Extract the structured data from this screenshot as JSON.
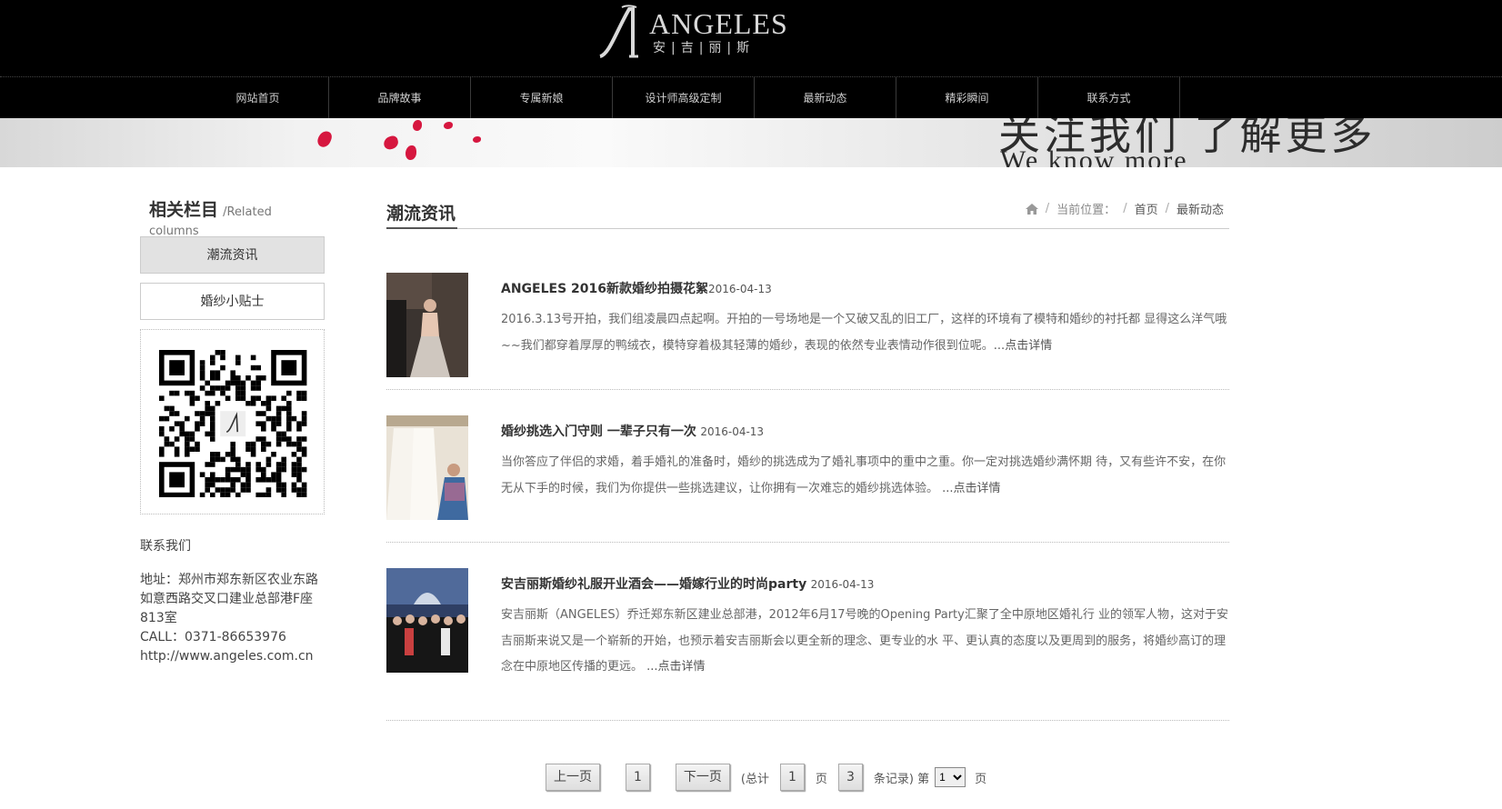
{
  "header": {
    "logo_en": "ANGELES",
    "logo_cn": "安|吉|丽|斯"
  },
  "nav": {
    "items": [
      "网站首页",
      "品牌故事",
      "专属新娘",
      "设计师高级定制",
      "最新动态",
      "精彩瞬间",
      "联系方式"
    ]
  },
  "banner": {
    "slogan": "关注我们 了解更多",
    "slogan_en": "We know more"
  },
  "sidebar": {
    "title_cn": "相关栏目",
    "title_en": "/Related columns",
    "items": [
      "潮流资讯",
      "婚纱小贴士"
    ],
    "contact_title": "联系我们",
    "address_line1": "地址：郑州市郑东新区农业东路",
    "address_line2": "如意西路交叉口建业总部港F座",
    "address_line3": "813室",
    "phone": "CALL：0371-86653976",
    "website": "http://www.angeles.com.cn"
  },
  "main": {
    "title": "潮流资讯",
    "breadcrumb": {
      "prefix": "当前位置：",
      "home": "首页",
      "current": "最新动态"
    },
    "articles": [
      {
        "title": "ANGELES 2016新款婚纱拍摄花絮",
        "date": "2016-04-13",
        "summary": "2016.3.13号开拍，我们组凌晨四点起啊。开拍的一号场地是一个又破又乱的旧工厂，这样的环境有了模特和婚纱的衬托都 显得这么洋气哦~~我们都穿着厚厚的鸭绒衣，模特穿着极其轻薄的婚纱，表现的依然专业表情动作很到位呢。",
        "more": "...点击详情"
      },
      {
        "title": "婚纱挑选入门守则 一辈子只有一次",
        "date": "2016-04-13",
        "summary": "当你答应了伴侣的求婚，着手婚礼的准备时，婚纱的挑选成为了婚礼事项中的重中之重。你一定对挑选婚纱满怀期 待，又有些许不安，在你无从下手的时候，我们为你提供一些挑选建议，让你拥有一次难忘的婚纱挑选体验。",
        "more": "...点击详情"
      },
      {
        "title": "安吉丽斯婚纱礼服开业酒会——婚嫁行业的时尚party",
        "date": "2016-04-13",
        "summary": "安吉丽斯（ANGELES）乔迁郑东新区建业总部港，2012年6月17号晚的Opening Party汇聚了全中原地区婚礼行 业的领军人物，这对于安吉丽斯来说又是一个崭新的开始，也预示着安吉丽斯会以更全新的理念、更专业的水 平、更认真的态度以及更周到的服务，将婚纱高订的理念在中原地区传播的更远。",
        "more": "...点击详情"
      }
    ]
  },
  "pager": {
    "prev": "上一页",
    "current_page": "1",
    "next": "下一页",
    "total_prefix": "(总计",
    "total_pages": "1",
    "pages_unit": "页",
    "total_records": "3",
    "records_suffix": "条记录) 第",
    "select_value": "1",
    "page_unit": "页"
  },
  "colors": {
    "header_bg": "#000000",
    "petal": "#d6173f"
  }
}
